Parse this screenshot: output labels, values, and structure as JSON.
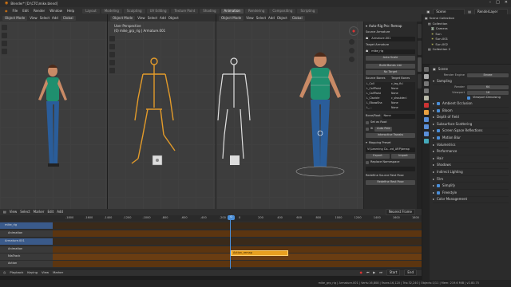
{
  "window": {
    "title": "Blender* [D:\\CTC\\mike.blend]",
    "controls": [
      "–",
      "□",
      "✕"
    ]
  },
  "menu": {
    "items": [
      "File",
      "Edit",
      "Render",
      "Window",
      "Help"
    ],
    "workspaces": [
      "Layout",
      "Modeling",
      "Sculpting",
      "UV Editing",
      "Texture Paint",
      "Shading",
      "Animation",
      "Rendering",
      "Compositing",
      "Scripting",
      "Animation"
    ],
    "active_workspace": "Animation",
    "scene": "Scene",
    "view_layer": "RenderLayer"
  },
  "left_view": {
    "mode": "Object Mode",
    "menus": [
      "View",
      "Select",
      "Add",
      "Object"
    ],
    "orientation": "Global"
  },
  "mid_view": {
    "mode": "Object Mode",
    "menus": [
      "View",
      "Select",
      "Add",
      "Object"
    ],
    "orientation": "Global",
    "title": "User Perspective",
    "subtitle": "(0) mike_grp_rig | Armature.001"
  },
  "right_view": {
    "mode": "Object Mode",
    "menus": [
      "View",
      "Select",
      "Add",
      "Object"
    ],
    "orientation": "Global"
  },
  "npanel": {
    "title": "Auto-Rig Pro: Remap",
    "source_label": "Source Armature",
    "source_value": "Armature.001",
    "target_label": "Target Armature",
    "target_value": "mike_rig",
    "auto_scale": "Auto Scale",
    "build_bones": "Build Bones List",
    "no_target": "No Target",
    "col_source": "Source Bones",
    "col_target": "Target Bones",
    "bones": [
      {
        "s": "L_Coll",
        "t": "c_leg_fk.l"
      },
      {
        "s": "L_CalfTwist",
        "t": "None"
      },
      {
        "s": "L_CalfTwist",
        "t": "None"
      },
      {
        "s": "L_Clavicle",
        "t": "c_shoulder.l"
      },
      {
        "s": "L_ElbowSha",
        "t": "None"
      },
      {
        "s": "L_...",
        "t": "None"
      }
    ],
    "bone_field": "Bone/Root",
    "bone_value": "None",
    "set_as_root": "Set as Root",
    "ik_pole": "Auto Pole",
    "ik_label": "IK",
    "interactive_tweaks": "Interactive Tweaks",
    "mapping_preset": "Mapping Preset",
    "preset_path": "V:\\Learning Co...ed_ARP\\bmap",
    "export": "Export",
    "import": "Import",
    "replace_namespace": "Replace Namespace",
    "source_ns": "",
    "redefine_pose": "Redefine Source Rest Pose",
    "redefine_btn": "Redefine Rest Pose"
  },
  "outliner": {
    "header": "Scene Collection",
    "items": [
      "Collection",
      "Camera",
      "Sun",
      "Sun.001",
      "Sun.002",
      "Collection 2"
    ]
  },
  "properties": {
    "section": "Scene",
    "render_engine_label": "Render Engine",
    "render_engine_value": "Eevee",
    "sampling": "Sampling",
    "render_label": "Render",
    "render_value": "64",
    "viewport_label": "Viewport",
    "viewport_value": "16",
    "viewport_denoising": "Viewport Denoising",
    "sections": [
      "Ambient Occlusion",
      "Bloom",
      "Depth of Field",
      "Subsurface Scattering",
      "Screen Space Reflections",
      "Motion Blur",
      "Volumetrics",
      "Performance",
      "Hair",
      "Shadows",
      "Indirect Lighting",
      "Film",
      "Simplify",
      "Freestyle",
      "Color Management"
    ],
    "checked": [
      "Ambient Occlusion",
      "Bloom",
      "Screen Space Reflections",
      "Motion Blur",
      "Simplify",
      "Freestyle"
    ]
  },
  "nla": {
    "menus": [
      "View",
      "Select",
      "Marker",
      "Edit",
      "Add"
    ],
    "nearest_frame": "Nearest Frame",
    "ruler_ticks": [
      "-1800",
      "-1600",
      "-1400",
      "-1200",
      "-1000",
      "-800",
      "-600",
      "-400",
      "-200",
      "0",
      "200",
      "400",
      "600",
      "800",
      "1000",
      "1200",
      "1400",
      "1600",
      "1800"
    ],
    "current_frame": "0",
    "tracks": [
      "mike_rig",
      "Animation",
      "Armature.001",
      "NlaTrack",
      "Action"
    ],
    "strip": "Action_remap",
    "footer": [
      "Playback",
      "Keying",
      "View",
      "Marker"
    ],
    "start": "Start",
    "end": "End"
  },
  "status": {
    "text": "mike_grp_rig | Armature.001 | Verts:16,808 | Faces:16,120 | Tris:32,240 | Objects:1/11 | Mem: 219.6 MiB | v2.80.75"
  },
  "colors": {
    "accent": "#4b8fd8",
    "strip": "#e8a020",
    "bone_orange": "#e39b2a",
    "track": "#5c3510"
  }
}
